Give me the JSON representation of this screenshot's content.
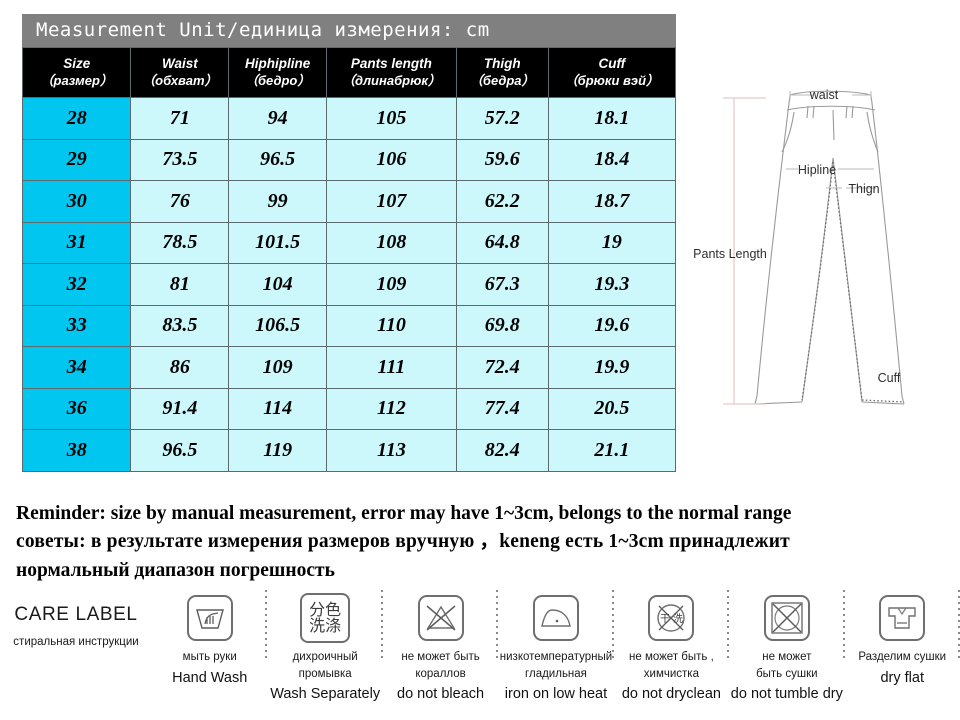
{
  "table": {
    "title": "Measurement Unit/единица измерения: cm",
    "columns": [
      {
        "en": "Size",
        "ru": "（размер）"
      },
      {
        "en": "Waist",
        "ru": "（обхват）"
      },
      {
        "en": "Hiphipline",
        "ru": "（бедро）"
      },
      {
        "en": "Pants length",
        "ru": "（длинабрюк）"
      },
      {
        "en": "Thigh",
        "ru": "（бедра）"
      },
      {
        "en": "Cuff",
        "ru": "（брюки вэй）"
      }
    ],
    "rows": [
      [
        "28",
        "71",
        "94",
        "105",
        "57.2",
        "18.1"
      ],
      [
        "29",
        "73.5",
        "96.5",
        "106",
        "59.6",
        "18.4"
      ],
      [
        "30",
        "76",
        "99",
        "107",
        "62.2",
        "18.7"
      ],
      [
        "31",
        "78.5",
        "101.5",
        "108",
        "64.8",
        "19"
      ],
      [
        "32",
        "81",
        "104",
        "109",
        "67.3",
        "19.3"
      ],
      [
        "33",
        "83.5",
        "106.5",
        "110",
        "69.8",
        "19.6"
      ],
      [
        "34",
        "86",
        "109",
        "111",
        "72.4",
        "19.9"
      ],
      [
        "36",
        "91.4",
        "114",
        "112",
        "77.4",
        "20.5"
      ],
      [
        "38",
        "96.5",
        "119",
        "113",
        "82.4",
        "21.1"
      ]
    ]
  },
  "diagram": {
    "labels": {
      "waist": "waist",
      "hipline": "Hipline",
      "thigh": "Thign",
      "pants_length": "Pants Length",
      "cuff": "Cuff"
    }
  },
  "reminder": {
    "line1": "Reminder: size by manual measurement, error may have 1~3cm, belongs to the normal range",
    "line2": "советы: в результате измерения размеров вручную ，keneng  есть  1~3cm  принадлежит",
    "line3": "нормальный диапазон  погрешность"
  },
  "care_label": {
    "title": "CARE LABEL",
    "subtitle": "стиральная инструкции",
    "items": [
      {
        "icon": "hand-wash-icon",
        "ru_lines": [
          "мыть руки"
        ],
        "en": "Hand Wash"
      },
      {
        "icon": "wash-separately-icon",
        "cn_top": "分色",
        "cn_bottom": "洗涤",
        "ru_lines": [
          "дихроичный",
          "промывка"
        ],
        "en": "Wash Separately"
      },
      {
        "icon": "do-not-bleach-icon",
        "ru_lines": [
          "не  может быть",
          "кораллов"
        ],
        "en": "do not bleach"
      },
      {
        "icon": "iron-low-heat-icon",
        "ru_lines": [
          "низкотемпературный",
          "гладильная"
        ],
        "en": "iron on low heat"
      },
      {
        "icon": "do-not-dryclean-icon",
        "cn_left": "干",
        "cn_right": "洗",
        "ru_lines": [
          "не  может быть ,",
          "химчистка"
        ],
        "en": "do not dryclean"
      },
      {
        "icon": "do-not-tumble-dry-icon",
        "ru_lines": [
          "не  может",
          "быть  сушки"
        ],
        "en": "do not tumble dry"
      },
      {
        "icon": "dry-flat-icon",
        "ru_lines": [
          "Разделим  сушки"
        ],
        "en": "dry flat"
      }
    ]
  },
  "colors": {
    "title_bar": "#808080",
    "header_row": "#000000",
    "size_column": "#00C6F0",
    "data_cell": "#CCF8FC",
    "grid_line": "#5a6a6e"
  }
}
